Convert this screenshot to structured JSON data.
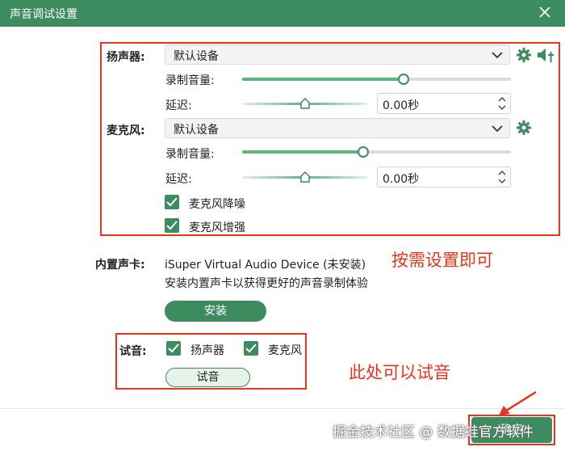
{
  "window": {
    "title": "声音调试设置"
  },
  "speaker": {
    "label": "扬声器:",
    "device": "默认设备",
    "volume_label": "录制音量:",
    "volume": 0.6,
    "delay_label": "延迟:",
    "delay_value": "0.00秒"
  },
  "microphone": {
    "label": "麦克风:",
    "device": "默认设备",
    "volume_label": "录制音量:",
    "volume": 0.45,
    "delay_label": "延迟:",
    "delay_value": "0.00秒",
    "noise_reduction_label": "麦克风降噪",
    "enhance_label": "麦克风增强"
  },
  "builtin_card": {
    "label": "内置声卡:",
    "device_name": "iSuper Virtual Audio Device (未安装)",
    "hint": "安装内置声卡以获得更好的声音录制体验",
    "install_label": "安装"
  },
  "test": {
    "label": "试音:",
    "speaker_label": "扬声器",
    "mic_label": "麦克风",
    "button_label": "试音"
  },
  "annotations": {
    "settings_note": "按需设置即可",
    "test_note": "此处可以试音"
  },
  "footer": {
    "watermark": "掘金技术社区 @ 数据蛙官方软件",
    "ok_label": "确定"
  },
  "colors": {
    "accent": "#3d8c5f",
    "annotation": "#e8341c"
  }
}
